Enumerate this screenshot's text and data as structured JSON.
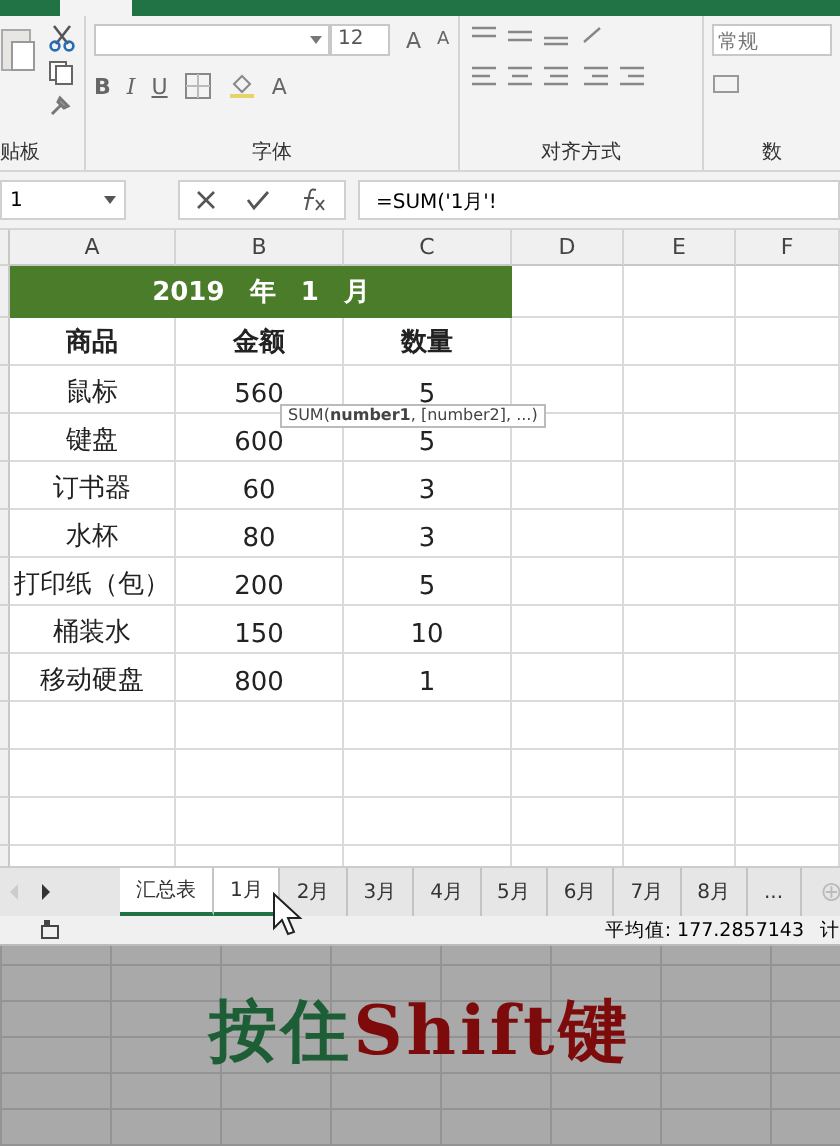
{
  "ribbon": {
    "clipboard_label": "贴板",
    "font_size": "12",
    "size_buttons": [
      "A",
      "A"
    ],
    "style_buttons": [
      "B",
      "I",
      "U"
    ],
    "font_color_button": "A",
    "font_label": "字体",
    "align_label": "对齐方式",
    "number_format": "常规",
    "number_label": "数"
  },
  "formula_bar": {
    "name_box": "1",
    "formula": "=SUM('1月'!"
  },
  "columns": [
    "A",
    "B",
    "C",
    "D",
    "E",
    "F"
  ],
  "sheet": {
    "title": "2019 年 1 月",
    "headers": [
      "商品",
      "金额",
      "数量"
    ],
    "rows": [
      [
        "鼠标",
        "560",
        "5"
      ],
      [
        "键盘",
        "600",
        "5"
      ],
      [
        "订书器",
        "60",
        "3"
      ],
      [
        "水杯",
        "80",
        "3"
      ],
      [
        "打印纸（包）",
        "200",
        "5"
      ],
      [
        "桶装水",
        "150",
        "10"
      ],
      [
        "移动硬盘",
        "800",
        "1"
      ]
    ]
  },
  "tooltip": "SUM(**number1**, [number2], ...)",
  "sheet_tabs": [
    {
      "label": "汇总表",
      "selected": true
    },
    {
      "label": "1月",
      "selected": true
    },
    {
      "label": "2月",
      "selected": false
    },
    {
      "label": "3月",
      "selected": false
    },
    {
      "label": "4月",
      "selected": false
    },
    {
      "label": "5月",
      "selected": false
    },
    {
      "label": "6月",
      "selected": false
    },
    {
      "label": "7月",
      "selected": false
    },
    {
      "label": "8月",
      "selected": false
    },
    {
      "label": "...",
      "selected": false
    }
  ],
  "status_bar": {
    "average": "平均值: 177.2857143",
    "next": "计"
  },
  "caption": [
    {
      "text": "按住",
      "color": "#1d5e36"
    },
    {
      "text": "Shift键",
      "color": "#7d0b0b"
    }
  ]
}
